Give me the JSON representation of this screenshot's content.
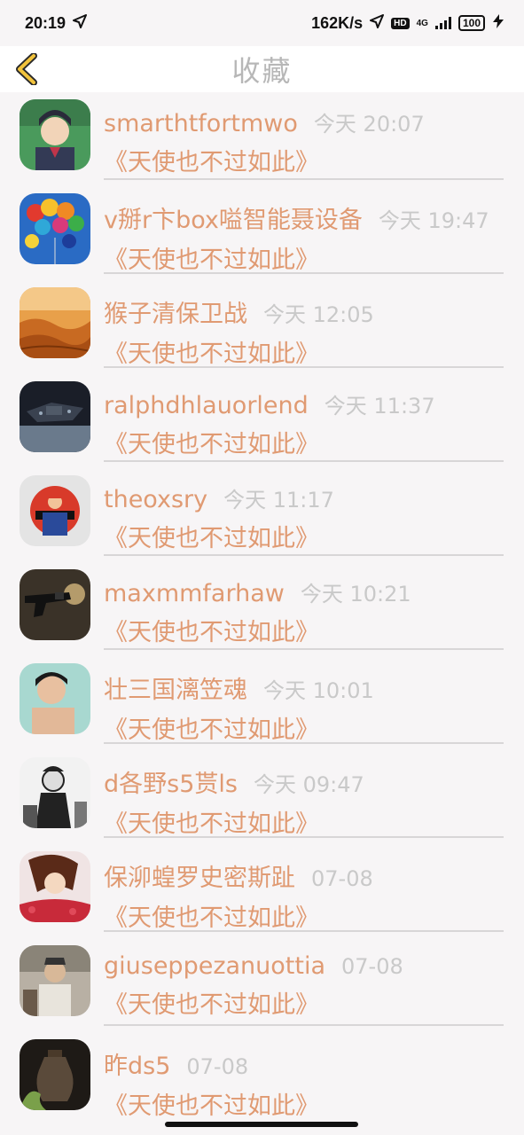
{
  "status_bar": {
    "time": "20:19",
    "net_speed": "162K/s",
    "hd_label": "HD",
    "network_type": "4G",
    "battery_level": "100"
  },
  "nav": {
    "title": "收藏",
    "back_icon": "chevron-left-icon"
  },
  "colors": {
    "accent": "#e09a72",
    "back_icon": "#f2c33c",
    "title": "#b7b7b7",
    "time": "#c9c9c9",
    "background": "#f7f5f6"
  },
  "items": [
    {
      "name": "smarthtfortmwo",
      "time": "今天 20:07",
      "subject": "《天使也不过如此》"
    },
    {
      "name": "v掰r卞box嗌智能聂设备",
      "time": "今天 19:47",
      "subject": "《天使也不过如此》"
    },
    {
      "name": "猴子清保卫战",
      "time": "今天 12:05",
      "subject": "《天使也不过如此》"
    },
    {
      "name": "ralphdhlauorlend",
      "time": "今天 11:37",
      "subject": "《天使也不过如此》"
    },
    {
      "name": "theoxsry",
      "time": "今天 11:17",
      "subject": "《天使也不过如此》"
    },
    {
      "name": "maxmmfarhaw",
      "time": "今天 10:21",
      "subject": "《天使也不过如此》"
    },
    {
      "name": "壮三国漓笠魂",
      "time": "今天 10:01",
      "subject": "《天使也不过如此》"
    },
    {
      "name": "d各野s5贳ls",
      "time": "今天 09:47",
      "subject": "《天使也不过如此》"
    },
    {
      "name": "保泖蝗罗史密斯趾",
      "time": "07-08",
      "subject": "《天使也不过如此》"
    },
    {
      "name": "giuseppezanuottia",
      "time": "07-08",
      "subject": "《天使也不过如此》"
    },
    {
      "name": "昨ds5",
      "time": "07-08",
      "subject": "《天使也不过如此》"
    }
  ]
}
